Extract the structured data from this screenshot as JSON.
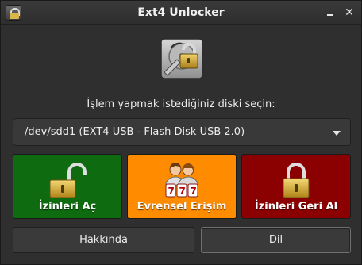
{
  "window": {
    "title": "Ext4 Unlocker",
    "close_glyph": "✕"
  },
  "icons": {
    "app": "app-lock-icon",
    "hero": "drive-with-padlock-icon",
    "open": "unlocked-padlock-icon",
    "public": "users-icon",
    "revoke": "locked-padlock-icon",
    "minimize": "minimize-icon",
    "close": "close-icon",
    "dropdown": "chevron-down-icon"
  },
  "prompt": "İşlem yapmak istediğiniz diski seçin:",
  "disk_select": {
    "selected": "/dev/sdd1 (EXT4 USB - Flash Disk USB 2.0)"
  },
  "actions": {
    "open_label": "İzinleri Aç",
    "public_label": "Evrensel Erişim",
    "revoke_label": "İzinleri Geri Al",
    "public_badge": "777"
  },
  "footer": {
    "about_label": "Hakkında",
    "language_label": "Dil"
  },
  "colors": {
    "open_bg": "#0f6b0f",
    "public_bg": "#ff8c00",
    "revoke_bg": "#8b0000",
    "window_bg": "#2f2f2f"
  }
}
